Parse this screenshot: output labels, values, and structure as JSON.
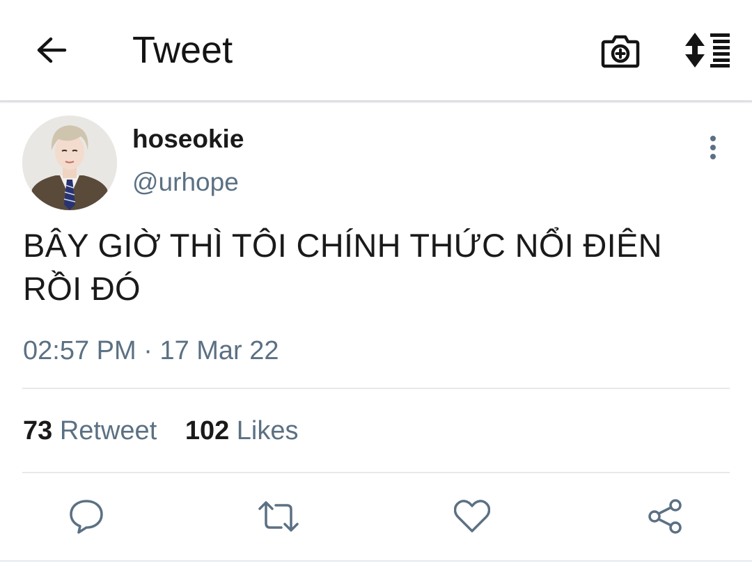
{
  "header": {
    "title": "Tweet",
    "back_icon": "arrow-left-icon",
    "camera_icon": "camera-plus-icon",
    "sort_icon": "sort-list-icon"
  },
  "tweet": {
    "author": {
      "display_name": "hoseokie",
      "handle": "@urhope"
    },
    "text": "BÂY GIỜ THÌ TÔI CHÍNH THỨC NỔI ĐIÊN RỒI ĐÓ",
    "time": "02:57 PM",
    "separator": "·",
    "date": "17 Mar 22",
    "stats": {
      "retweet_count": "73",
      "retweet_label": "Retweet",
      "likes_count": "102",
      "likes_label": "Likes"
    }
  },
  "actions": [
    {
      "name": "reply",
      "icon": "reply-bubble-icon"
    },
    {
      "name": "retweet",
      "icon": "retweet-icon"
    },
    {
      "name": "like",
      "icon": "heart-icon"
    },
    {
      "name": "share",
      "icon": "share-icon"
    }
  ],
  "colors": {
    "text_primary": "#1a1a1a",
    "text_secondary": "#5b7083",
    "divider": "#e6e9ec",
    "icon_grey": "#5b7083"
  }
}
